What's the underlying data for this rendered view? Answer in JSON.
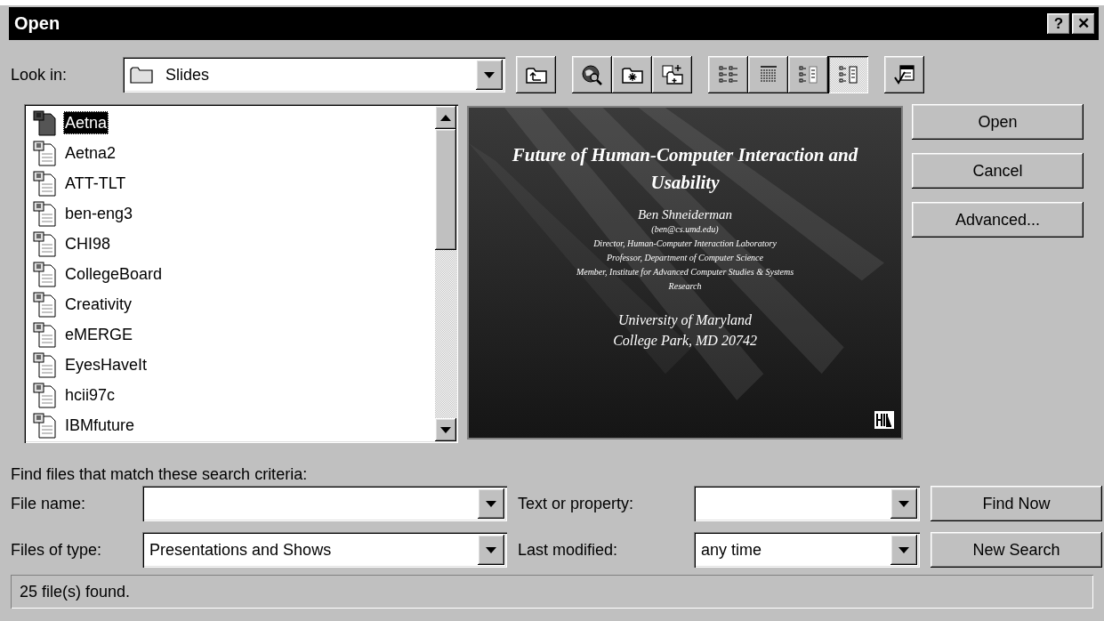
{
  "window": {
    "title": "Open",
    "help_button": "?",
    "close_button": "✕"
  },
  "look_in": {
    "label": "Look in:",
    "value": "Slides"
  },
  "toolbar": [
    {
      "kind": "up-folder",
      "selected": false
    },
    {
      "kind": "search-web",
      "selected": false
    },
    {
      "kind": "favorites",
      "selected": false
    },
    {
      "kind": "add-favorites",
      "selected": false
    },
    {
      "kind": "list-view",
      "selected": false
    },
    {
      "kind": "details-view",
      "selected": false
    },
    {
      "kind": "properties-view",
      "selected": false
    },
    {
      "kind": "preview-view",
      "selected": true
    },
    {
      "kind": "commands",
      "selected": false
    }
  ],
  "files": [
    {
      "name": "Aetna",
      "selected": true
    },
    {
      "name": "Aetna2",
      "selected": false
    },
    {
      "name": "ATT-TLT",
      "selected": false
    },
    {
      "name": "ben-eng3",
      "selected": false
    },
    {
      "name": "CHI98",
      "selected": false
    },
    {
      "name": "CollegeBoard",
      "selected": false
    },
    {
      "name": "Creativity",
      "selected": false
    },
    {
      "name": "eMERGE",
      "selected": false
    },
    {
      "name": "EyesHaveIt",
      "selected": false
    },
    {
      "name": "hcii97c",
      "selected": false
    },
    {
      "name": "IBMfuture",
      "selected": false
    }
  ],
  "preview": {
    "title": "Future of Human-Computer Interaction and Usability",
    "author": "Ben Shneiderman",
    "email": "(ben@cs.umd.edu)",
    "roles": [
      "Director, Human-Computer Interaction Laboratory",
      "Professor, Department of Computer Science",
      "Member, Institute for Advanced Computer Studies & Systems Research"
    ],
    "place": [
      "University of Maryland",
      "College Park, MD 20742"
    ]
  },
  "buttons": [
    {
      "label": "Open"
    },
    {
      "label": "Cancel"
    },
    {
      "label": "Advanced..."
    }
  ],
  "search": {
    "heading": "Find files that match these search criteria:",
    "file_name": {
      "label": "File name:"
    },
    "text_or_property": {
      "label": "Text or property:"
    },
    "files_of_type": {
      "label": "Files of type:",
      "value": "Presentations and Shows"
    },
    "last_modified": {
      "label": "Last modified:",
      "value": "any time"
    },
    "find_now": {
      "label": "Find Now"
    },
    "new_search": {
      "label": "New Search"
    }
  },
  "status_bar": "25 file(s) found."
}
